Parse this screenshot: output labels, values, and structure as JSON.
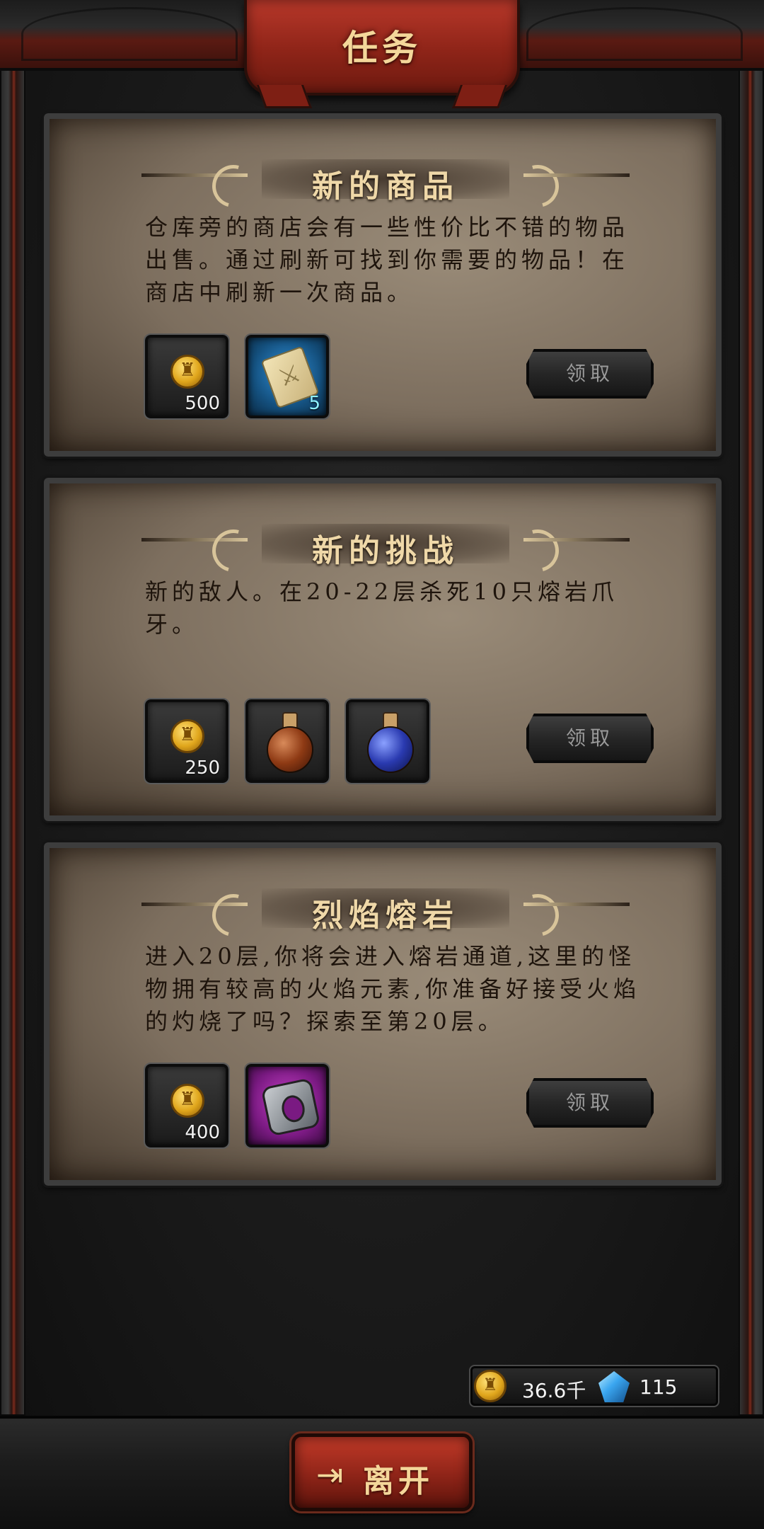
{
  "header": {
    "title": "任务"
  },
  "quests": [
    {
      "title": "新的商品",
      "description": "仓库旁的商店会有一些性价比不错的物品出售。通过刷新可找到你需要的物品！在商店中刷新一次商品。",
      "rewards": [
        {
          "icon": "gold-coin-icon",
          "count": "500"
        },
        {
          "icon": "scroll-icon",
          "count": "5",
          "rarity_color": "#1e6fb0"
        }
      ],
      "claim_label": "领取"
    },
    {
      "title": "新的挑战",
      "description": "新的敌人。在20-22层杀死10只熔岩爪牙。",
      "rewards": [
        {
          "icon": "gold-coin-icon",
          "count": "250"
        },
        {
          "icon": "health-potion-icon"
        },
        {
          "icon": "mana-potion-icon"
        }
      ],
      "claim_label": "领取"
    },
    {
      "title": "烈焰熔岩",
      "description": "进入20层,你将会进入熔岩通道,这里的怪物拥有较高的火焰元素,你准备好接受火焰的灼烧了吗？探索至第20层。",
      "rewards": [
        {
          "icon": "gold-coin-icon",
          "count": "400"
        },
        {
          "icon": "ring-icon",
          "rarity_color": "#8a1f96"
        }
      ],
      "claim_label": "领取"
    }
  ],
  "currency": {
    "gold": "36.6千",
    "gems": "115"
  },
  "footer": {
    "exit_label": "离开"
  },
  "colors": {
    "banner_red": "#8e2418",
    "title_gold": "#f4d79a",
    "parchment": "#a0917d"
  }
}
